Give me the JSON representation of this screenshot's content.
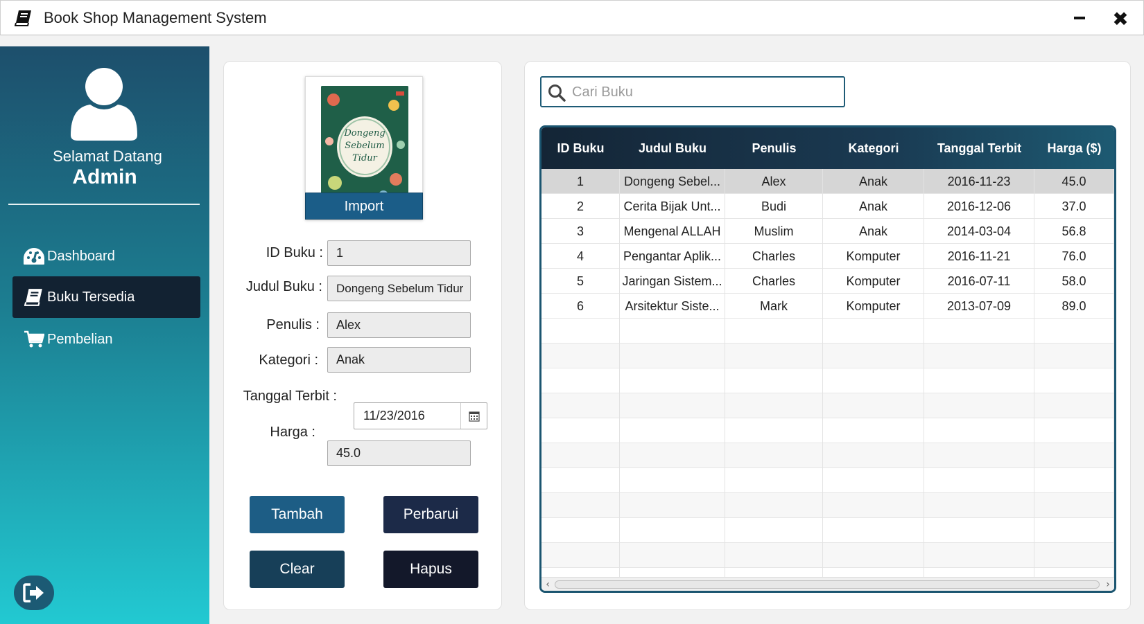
{
  "window": {
    "title": "Book Shop Management System"
  },
  "sidebar": {
    "welcome": "Selamat Datang",
    "user": "Admin",
    "items": [
      {
        "label": "Dashboard",
        "icon": "dashboard-icon"
      },
      {
        "label": "Buku Tersedia",
        "icon": "book-icon",
        "active": true
      },
      {
        "label": "Pembelian",
        "icon": "cart-icon"
      }
    ],
    "logout_icon": "logout-icon"
  },
  "form": {
    "cover_title": "Dongeng Sebelum Tidur",
    "import_label": "Import",
    "fields": {
      "id": {
        "label": "ID Buku :",
        "value": "1"
      },
      "judul": {
        "label": "Judul Buku :",
        "value": "Dongeng Sebelum Tidur"
      },
      "penulis": {
        "label": "Penulis :",
        "value": "Alex"
      },
      "kategori": {
        "label": "Kategori :",
        "value": "Anak"
      },
      "tanggal": {
        "label": "Tanggal Terbit :",
        "value": "11/23/2016"
      },
      "harga": {
        "label": "Harga :",
        "value": "45.0"
      }
    },
    "buttons": {
      "tambah": "Tambah",
      "perbarui": "Perbarui",
      "clear": "Clear",
      "hapus": "Hapus"
    }
  },
  "search": {
    "placeholder": "Cari Buku"
  },
  "table": {
    "columns": [
      "ID Buku",
      "Judul Buku",
      "Penulis",
      "Kategori",
      "Tanggal Terbit",
      "Harga ($)"
    ],
    "rows": [
      [
        "1",
        "Dongeng Sebel...",
        "Alex",
        "Anak",
        "2016-11-23",
        "45.0"
      ],
      [
        "2",
        "Cerita Bijak Unt...",
        "Budi",
        "Anak",
        "2016-12-06",
        "37.0"
      ],
      [
        "3",
        "Mengenal ALLAH",
        "Muslim",
        "Anak",
        "2014-03-04",
        "56.8"
      ],
      [
        "4",
        "Pengantar Aplik...",
        "Charles",
        "Komputer",
        "2016-11-21",
        "76.0"
      ],
      [
        "5",
        "Jaringan Sistem...",
        "Charles",
        "Komputer",
        "2016-07-11",
        "58.0"
      ],
      [
        "6",
        "Arsitektur Siste...",
        "Mark",
        "Komputer",
        "2013-07-09",
        "89.0"
      ]
    ],
    "selected_row": 0
  },
  "colors": {
    "header_dark": "#142536",
    "accent": "#1b5d88",
    "sidebar_top": "#1d4f6c",
    "sidebar_bottom": "#22c9d2"
  }
}
